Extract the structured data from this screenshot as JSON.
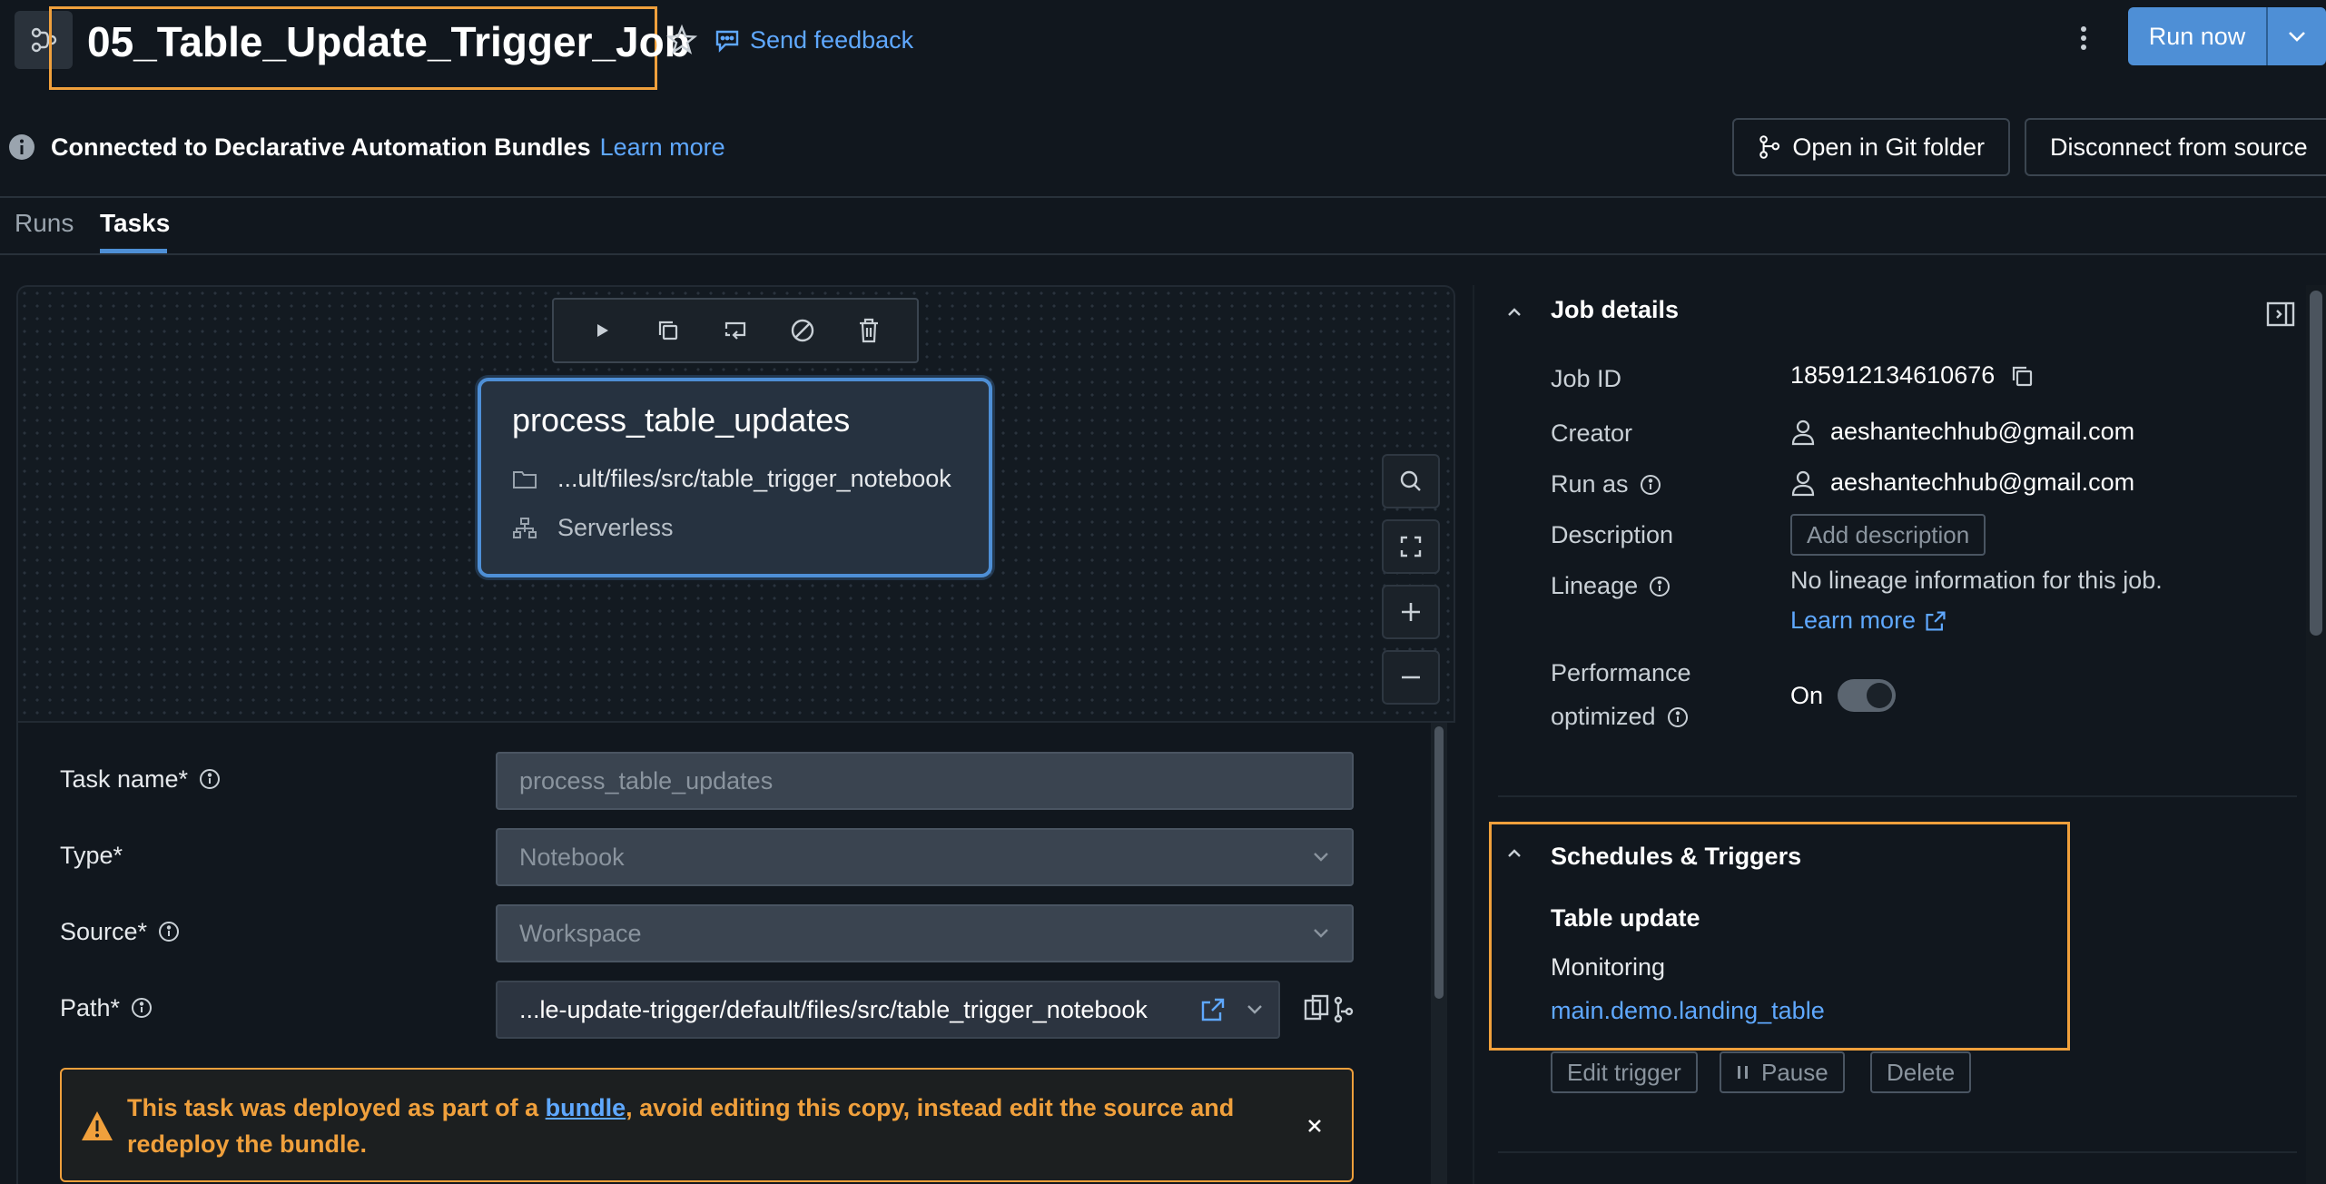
{
  "header": {
    "title": "05_Table_Update_Trigger_Job",
    "feedback_label": "Send feedback",
    "run_now_label": "Run now"
  },
  "bundle_banner": {
    "text": "Connected to Declarative Automation Bundles",
    "learn_more": "Learn more",
    "open_git_label": "Open in Git folder",
    "disconnect_label": "Disconnect from source"
  },
  "tabs": [
    {
      "label": "Runs",
      "active": false
    },
    {
      "label": "Tasks",
      "active": true
    }
  ],
  "task_node": {
    "name": "process_table_updates",
    "path": "...ult/files/src/table_trigger_notebook",
    "compute": "Serverless"
  },
  "task_form": {
    "task_name_label": "Task name*",
    "task_name_value": "process_table_updates",
    "type_label": "Type*",
    "type_value": "Notebook",
    "source_label": "Source*",
    "source_value": "Workspace",
    "path_label": "Path*",
    "path_value": "...le-update-trigger/default/files/src/table_trigger_notebook"
  },
  "warning": {
    "text_before": "This task was deployed as part of a ",
    "link": "bundle",
    "text_after": ", avoid editing this copy, instead edit the source and redeploy the bundle."
  },
  "job_details": {
    "heading": "Job details",
    "job_id_label": "Job ID",
    "job_id": "185912134610676",
    "creator_label": "Creator",
    "creator": "aeshantechhub@gmail.com",
    "run_as_label": "Run as",
    "run_as": "aeshantechhub@gmail.com",
    "description_label": "Description",
    "add_description": "Add description",
    "lineage_label": "Lineage",
    "lineage_text": "No lineage information for this job.",
    "lineage_learn_more": "Learn more",
    "performance_label_1": "Performance",
    "performance_label_2": "optimized",
    "performance_value": "On"
  },
  "schedules": {
    "heading": "Schedules & Triggers",
    "trigger_type": "Table update",
    "monitoring_label": "Monitoring",
    "table": "main.demo.landing_table",
    "edit_label": "Edit trigger",
    "pause_label": "Pause",
    "delete_label": "Delete"
  },
  "colors": {
    "background": "#11171e",
    "accent": "#4e8fd6",
    "link": "#5fa8ff",
    "highlight": "#f0a03c"
  }
}
